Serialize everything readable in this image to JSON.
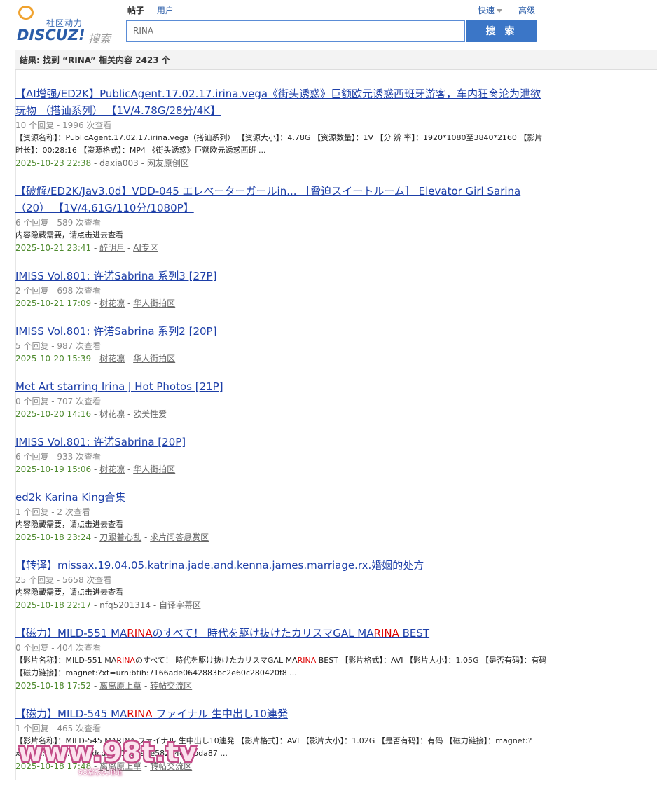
{
  "logo": {
    "cn": "社区动力",
    "brand": "DISCUZ!",
    "suffix": "搜索"
  },
  "tabs": {
    "posts": "帖子",
    "users": "用户"
  },
  "quick_label": "快速",
  "advanced_label": "高级",
  "search": {
    "value": "RINA",
    "button": "搜 索"
  },
  "results_summary": "结果: 找到 “RINA” 相关内容 2423 个",
  "results": [
    {
      "title": "【AI增强/ED2K】PublicAgent.17.02.17.irina.vega《街头诱惑》巨额欧元诱惑西班牙游客，车内狂肏沦为泄欲玩物 （搭讪系列） 【1V/4.78G/28分/4K】",
      "meta": "10 个回复 - 1996 次查看",
      "desc": "【资源名称】：PublicAgent.17.02.17.irina.vega（搭讪系列） 【资源大小】：4.78G 【资源数量】：1V 【分 辨 率】：1920*1080至3840*2160 【影片时长】：00:28:16 【资源格式】：MP4 《街头诱惑》巨额欧元诱惑西班 ...",
      "date": "2025-10-23 22:38",
      "author": "daxia003",
      "forum": "网友原创区"
    },
    {
      "title": "【破解/ED2K/Jav3.0d】VDD-045 エレベーターガールin... ［脅迫スイートルーム］ Elevator Girl Sarina （20） 【1V/4.61G/110分/1080P】",
      "meta": "6 个回复 - 589 次查看",
      "desc": "内容隐藏需要，请点击进去查看",
      "date": "2025-10-21 23:41",
      "author": "醉明月",
      "forum": "AI专区"
    },
    {
      "title": "IMISS Vol.801: 许诺Sabrina 系列3 [27P]",
      "meta": "2 个回复 - 698 次查看",
      "desc": "",
      "date": "2025-10-21 17:09",
      "author": "树花凛",
      "forum": "华人街拍区"
    },
    {
      "title": "IMISS Vol.801: 许诺Sabrina 系列2 [20P]",
      "meta": "5 个回复 - 987 次查看",
      "desc": "",
      "date": "2025-10-20 15:39",
      "author": "树花凛",
      "forum": "华人街拍区"
    },
    {
      "title": "Met Art starring Irina J Hot Photos [21P]",
      "meta": "0 个回复 - 707 次查看",
      "desc": "",
      "date": "2025-10-20 14:16",
      "author": "树花凛",
      "forum": "欧美性爱"
    },
    {
      "title": "IMISS Vol.801: 许诺Sabrina [20P]",
      "meta": "6 个回复 - 933 次查看",
      "desc": "",
      "date": "2025-10-19 15:06",
      "author": "树花凛",
      "forum": "华人街拍区"
    },
    {
      "title": "ed2k Karina King合集",
      "meta": "1 个回复 - 2 次查看",
      "desc": "内容隐藏需要，请点击进去查看",
      "date": "2025-10-18 23:24",
      "author": "刀跟着心乱",
      "forum": "求片问答悬赏区"
    },
    {
      "title": "【转译】missax.19.04.05.katrina.jade.and.kenna.james.marriage.rx.婚姻的处方",
      "meta": "25 个回复 - 5658 次查看",
      "desc": "内容隐藏需要，请点击进去查看",
      "date": "2025-10-18 22:17",
      "author": "nfq5201314",
      "forum": "自译字幕区"
    },
    {
      "title_pre": "【磁力】MILD-551 MA",
      "title_hl": "RINA",
      "title_post": "のすべて！ 時代を駆け抜けたカリスマGAL MA",
      "title_hl2": "RINA",
      "title_post2": " BEST",
      "meta": "0 个回复 - 404 次查看",
      "desc_pre": "【影片名称】：MILD-551 MA",
      "desc_hl": "RINA",
      "desc_mid": "のすべて！ 時代を駆け抜けたカリスマGAL MA",
      "desc_hl2": "RINA",
      "desc_post": " BEST 【影片格式】：AVI 【影片大小】：1.05G 【是否有码】：有码 【磁力链接】：magnet:?xt=urn:btih:7166ade0642883bc2e60c280420f8 ...",
      "date": "2025-10-18 17:52",
      "author": "离离原上草",
      "forum": "转帖交流区"
    },
    {
      "title_pre": "【磁力】MILD-545 MA",
      "title_hl": "RINA",
      "title_post": " ファイナル 生中出し10連発",
      "meta": "1 个回复 - 465 次查看",
      "desc": "【影片名称】：MILD-545 MARINA ファイナル 生中出し10連発 【影片格式】：AVI 【影片大小】：1.02G 【是否有码】：有码 【磁力链接】：magnet:?xt=urn:btih:...6f9d3dcd66b165b93e58244c83bda87 ...",
      "date": "2025-10-18 17:48",
      "author": "离离原上草",
      "forum": "转帖交流区"
    }
  ],
  "watermark": {
    "text": "www.98t.tv",
    "sub": "98堂永久地址"
  },
  "colors": {
    "link": "#1d3fa8",
    "date": "#4e8a2e",
    "highlight": "#dd0000",
    "button": "#3b76c7"
  }
}
